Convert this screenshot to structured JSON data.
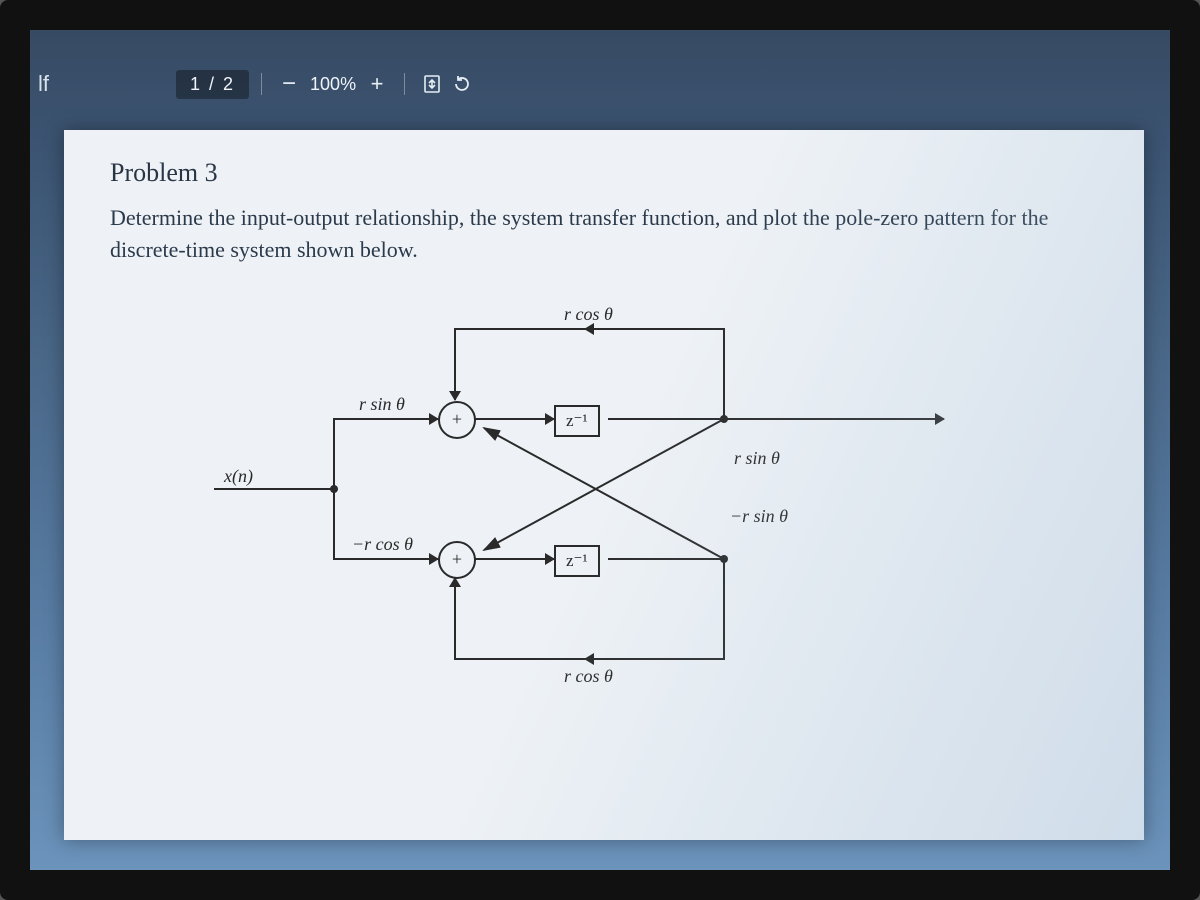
{
  "toolbar": {
    "doc_title_fragment": "lf",
    "page_indicator": "1  /  2",
    "zoom": "100%",
    "minus": "−",
    "plus": "+",
    "fit": "fit-page-icon",
    "rotate": "rotate-icon"
  },
  "problem": {
    "heading": "Problem 3",
    "body": "Determine the input-output relationship, the system transfer function, and plot the pole-zero pattern for the discrete-time system shown below."
  },
  "diagram": {
    "input": "x(n)",
    "gain_top_in": "r sin θ",
    "gain_bot_in": "−r cos θ",
    "delay": "z⁻¹",
    "fb_top": "r cos θ",
    "fb_bot": "r cos θ",
    "cross_top": "r sin θ",
    "cross_bot": "−r sin θ",
    "sum": "+"
  }
}
